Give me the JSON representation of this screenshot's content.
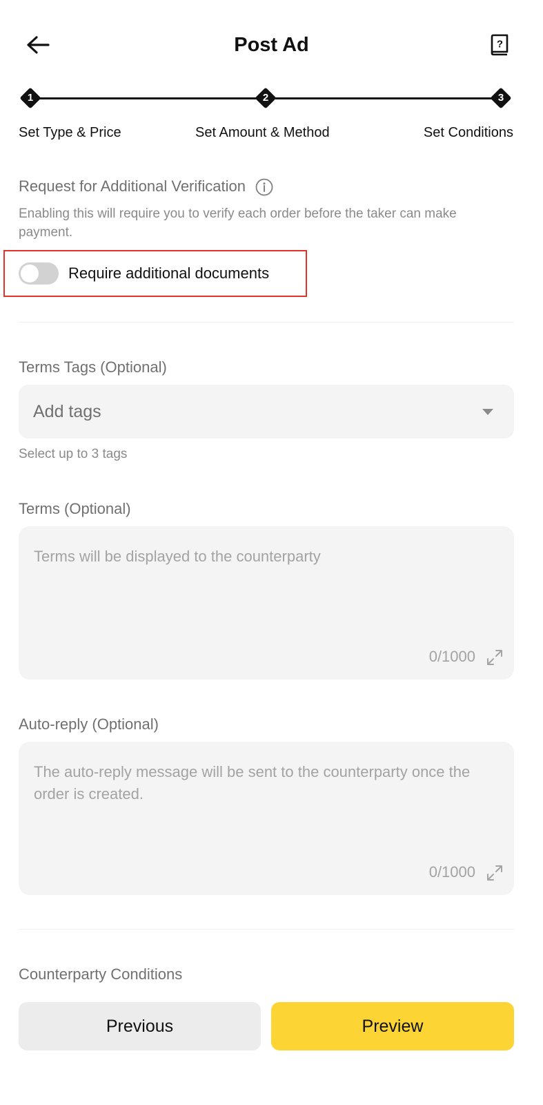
{
  "header": {
    "title": "Post Ad",
    "back_icon": "arrow-left-icon",
    "help_icon": "help-book-icon"
  },
  "stepper": {
    "steps": [
      {
        "number": "1",
        "label": "Set Type & Price"
      },
      {
        "number": "2",
        "label": "Set Amount & Method"
      },
      {
        "number": "3",
        "label": "Set Conditions"
      }
    ]
  },
  "verification": {
    "title": "Request for Additional Verification",
    "description": "Enabling this will require you to verify each order before the taker can make payment.",
    "toggle_label": "Require additional documents",
    "toggle_on": false
  },
  "terms_tags": {
    "label": "Terms Tags (Optional)",
    "placeholder": "Add tags",
    "hint": "Select up to 3 tags"
  },
  "terms": {
    "label": "Terms (Optional)",
    "placeholder": "Terms will be displayed to the counterparty",
    "counter": "0/1000"
  },
  "auto_reply": {
    "label": "Auto-reply (Optional)",
    "placeholder": "The auto-reply message will be sent to the counterparty once the order is created.",
    "counter": "0/1000"
  },
  "counterparty": {
    "label": "Counterparty Conditions"
  },
  "footer": {
    "previous_label": "Previous",
    "preview_label": "Preview"
  },
  "colors": {
    "accent": "#FCD535",
    "highlight_border": "#E2332A",
    "muted_text": "#707070"
  }
}
